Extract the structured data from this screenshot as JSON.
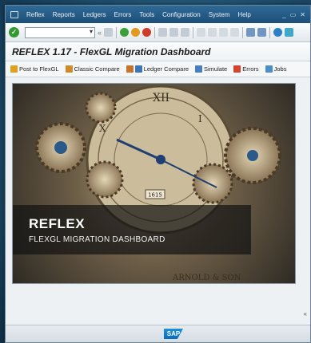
{
  "menu": {
    "items": [
      "Reflex",
      "Reports",
      "Ledgers",
      "Errors",
      "Tools",
      "Configuration",
      "System",
      "Help"
    ]
  },
  "toolbar": {
    "command_placeholder": "",
    "back_symbol": "«"
  },
  "title": "REFLEX 1.17 - FlexGL Migration Dashboard",
  "app_toolbar": {
    "buttons": [
      "Post to FlexGL",
      "Classic Compare",
      "Ledger Compare",
      "Simulate",
      "Errors",
      "Jobs"
    ]
  },
  "banner": {
    "title": "REFLEX",
    "subtitle": "FLEXGL MIGRATION DASHBOARD"
  },
  "image_text": {
    "dial_number": "1615",
    "maker": "ARNOLD & SON"
  },
  "status": {
    "logo": "SAP",
    "collapse_symbol": "«"
  },
  "colors": {
    "menubar": "#2e6a98",
    "ok": "#2f9a2f",
    "accent": "#0a6bbd"
  }
}
